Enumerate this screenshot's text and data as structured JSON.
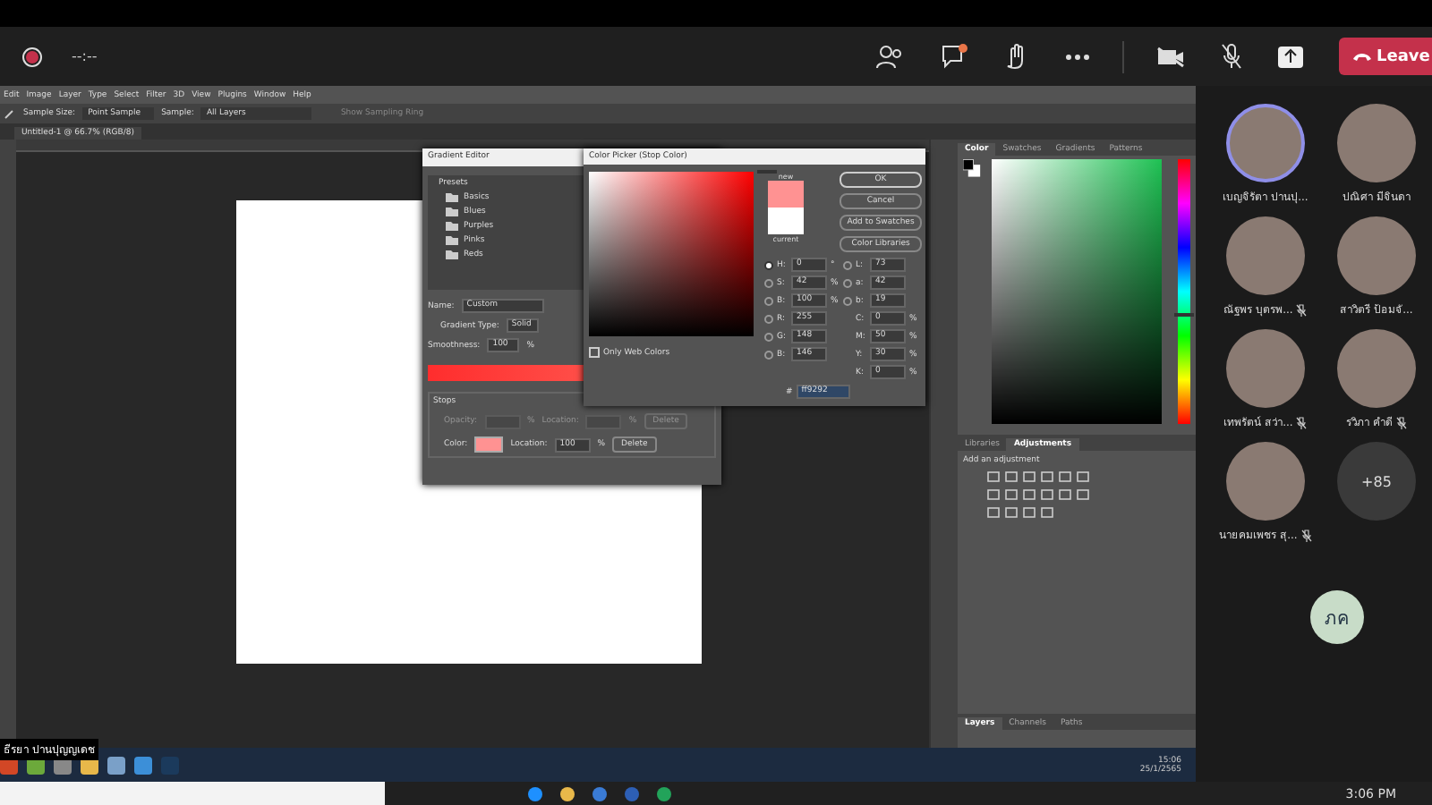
{
  "meeting": {
    "timer": "--:--",
    "camera_on": false,
    "mic_on": false,
    "leave_button": "Leave"
  },
  "photoshop": {
    "menu": [
      "Edit",
      "Image",
      "Layer",
      "Type",
      "Select",
      "Filter",
      "3D",
      "View",
      "Plugins",
      "Window",
      "Help"
    ],
    "options": [
      {
        "label": "Sample Size:",
        "value": "Point Sample"
      },
      {
        "label": "Sample:",
        "value": "All Layers"
      }
    ],
    "sampling_ring": "Show Sampling Ring",
    "doc_tab": "Untitled-1 @ 66.7% (RGB/8)",
    "gradient_editor": {
      "title": "Gradient Editor",
      "presets_label": "Presets",
      "folders": [
        "Basics",
        "Blues",
        "Purples",
        "Pinks",
        "Reds"
      ],
      "name_label": "Name:",
      "name_value": "Custom",
      "type_label": "Gradient Type:",
      "type_value": "Solid",
      "smooth_label": "Smoothness:",
      "smooth_value": "100",
      "smooth_unit": "%",
      "stops_label": "Stops",
      "stop_rows": [
        {
          "label": "Opacity:",
          "unit": "%",
          "loc_label": "Location:",
          "loc_unit": "%",
          "delete": "Delete",
          "disabled": true
        },
        {
          "label": "Color:",
          "loc_label": "Location:",
          "loc_value": "100",
          "loc_unit": "%",
          "delete": "Delete",
          "disabled": false
        }
      ],
      "stop_swatch": true
    },
    "color_picker": {
      "title": "Color Picker (Stop Color)",
      "buttons": [
        "OK",
        "Cancel",
        "Add to Swatches",
        "Color Libraries"
      ],
      "new_label": "new",
      "current_label": "current",
      "hue_slider": {
        "level": 1
      },
      "web_colors": {
        "label": "Only Web Colors",
        "checked": false
      },
      "left_fields": [
        {
          "label": "H:",
          "value": "0",
          "unit": "°",
          "kind": "radio",
          "selected": true
        },
        {
          "label": "S:",
          "value": "42",
          "unit": "%",
          "kind": "radio",
          "selected": false
        },
        {
          "label": "B:",
          "value": "100",
          "unit": "%",
          "kind": "radio",
          "selected": false
        },
        {
          "label": "R:",
          "value": "255",
          "kind": "radio",
          "selected": false
        },
        {
          "label": "G:",
          "value": "148",
          "kind": "radio",
          "selected": false
        },
        {
          "label": "B:",
          "value": "146",
          "kind": "radio",
          "selected": false
        }
      ],
      "right_fields": [
        {
          "label": "L:",
          "value": "73",
          "kind": "radio",
          "selected": false
        },
        {
          "label": "a:",
          "value": "42",
          "kind": "radio",
          "selected": false
        },
        {
          "label": "b:",
          "value": "19",
          "kind": "radio",
          "selected": false
        },
        {
          "label": "C:",
          "value": "0",
          "unit": "%",
          "kind": "plain"
        },
        {
          "label": "M:",
          "value": "50",
          "unit": "%",
          "kind": "plain"
        },
        {
          "label": "Y:",
          "value": "30",
          "unit": "%",
          "kind": "plain"
        },
        {
          "label": "K:",
          "value": "0",
          "unit": "%",
          "kind": "plain"
        }
      ],
      "hex_label": "#",
      "hex_value": "ff9292"
    },
    "color_tabs": [
      {
        "label": "Color",
        "selected": true
      },
      {
        "label": "Swatches",
        "selected": false
      },
      {
        "label": "Gradients",
        "selected": false
      },
      {
        "label": "Patterns",
        "selected": false
      }
    ],
    "color_hue_slider": {
      "level": 0.41
    },
    "adjust_tabs": [
      {
        "label": "Libraries",
        "selected": false
      },
      {
        "label": "Adjustments",
        "selected": true
      }
    ],
    "adjust_hint": "Add an adjustment",
    "layer_tabs": [
      {
        "label": "Layers",
        "selected": true
      },
      {
        "label": "Channels",
        "selected": false
      },
      {
        "label": "Paths",
        "selected": false
      }
    ]
  },
  "shared_taskbar": {
    "tooltip": "ธีรยา ปานปุญญเดช",
    "time": "15:06",
    "date": "25/1/2565"
  },
  "participants": [
    {
      "name": "เบญจิรัตา ปานปุ...",
      "muted": false,
      "speaking": true
    },
    {
      "name": "ปณิศา มีจินดา",
      "muted": false,
      "speaking": false
    },
    {
      "name": "ณัฐพร บุตรพ...",
      "muted": true,
      "speaking": false
    },
    {
      "name": "สาวิตรี ป้อมจั...",
      "muted": false,
      "speaking": false
    },
    {
      "name": "เทพรัตน์ สว่า...",
      "muted": true,
      "speaking": false
    },
    {
      "name": "รวิภา คำดี",
      "muted": true,
      "speaking": false
    },
    {
      "name": "นายคมเพชร สุ...",
      "muted": true,
      "speaking": false
    }
  ],
  "overflow_count": "+85",
  "self_initials": "ภค",
  "taskbar": {
    "time": "3:06 PM"
  }
}
